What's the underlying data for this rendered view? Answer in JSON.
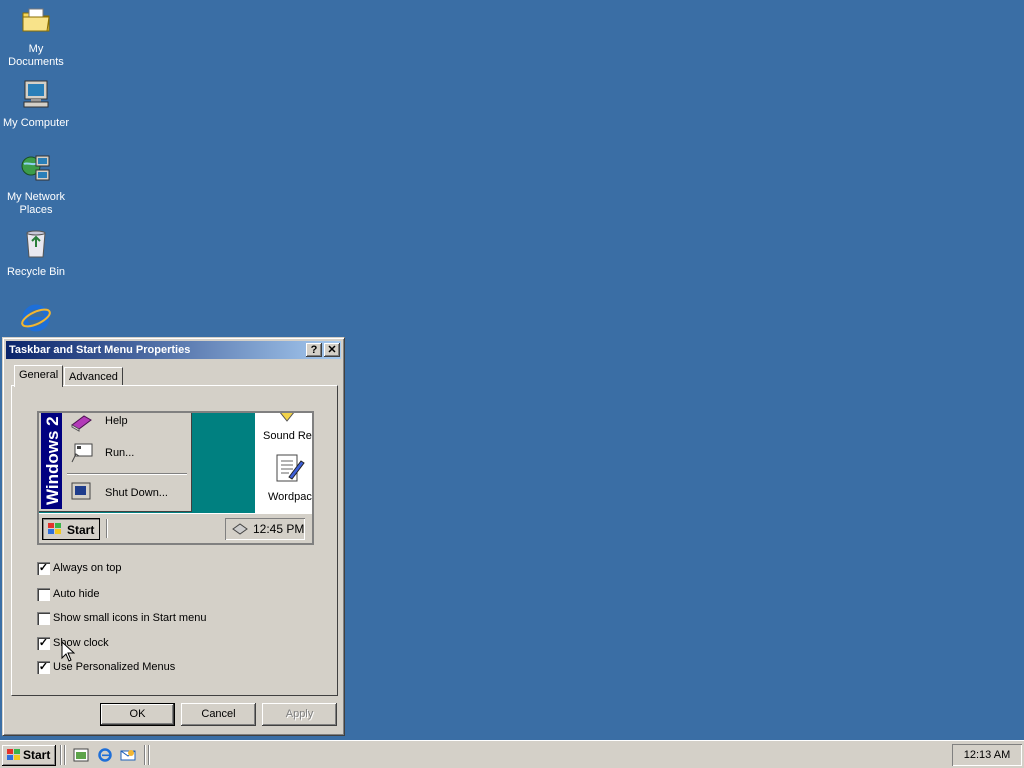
{
  "desktop": {
    "background": "#3A6EA5",
    "icons": [
      {
        "label": "My Documents",
        "icon": "folder-documents-icon"
      },
      {
        "label": "My Computer",
        "icon": "computer-icon"
      },
      {
        "label": "My Network Places",
        "icon": "network-places-icon"
      },
      {
        "label": "Recycle Bin",
        "icon": "recycle-bin-icon"
      },
      {
        "label": "",
        "icon": "internet-explorer-icon"
      }
    ]
  },
  "dialog": {
    "title": "Taskbar and Start Menu Properties",
    "help_label": "?",
    "close_label": "✕",
    "tabs": [
      {
        "label": "General",
        "active": true
      },
      {
        "label": "Advanced",
        "active": false
      }
    ],
    "preview": {
      "band_text": "Windows 2",
      "menu_items": [
        {
          "label": "Help",
          "icon": "help-book-icon"
        },
        {
          "label": "Run...",
          "icon": "run-icon"
        },
        {
          "label": "Shut Down...",
          "icon": "shutdown-icon"
        }
      ],
      "desktop_items": [
        {
          "label": "Sound Re",
          "icon": "sound-recorder-icon"
        },
        {
          "label": "Wordpac",
          "icon": "wordpad-icon"
        }
      ],
      "start_label": "Start",
      "clock": "12:45 PM"
    },
    "options": [
      {
        "label": "Always on top",
        "checked": true
      },
      {
        "label": "Auto hide",
        "checked": false
      },
      {
        "label": "Show small icons in Start menu",
        "checked": false
      },
      {
        "label": "Show clock",
        "checked": true
      },
      {
        "label": "Use Personalized Menus",
        "checked": true
      }
    ],
    "buttons": {
      "ok": "OK",
      "cancel": "Cancel",
      "apply": "Apply"
    }
  },
  "taskbar": {
    "start_label": "Start",
    "quick_launch": [
      "show-desktop-icon",
      "internet-explorer-icon",
      "outlook-express-icon"
    ],
    "clock": "12:13 AM"
  },
  "colors": {
    "desktop": "#3A6EA5",
    "title_active_start": "#0A246A",
    "title_active_end": "#A6CAF0",
    "face": "#D4D0C8",
    "preview_desktop": "#008080"
  }
}
